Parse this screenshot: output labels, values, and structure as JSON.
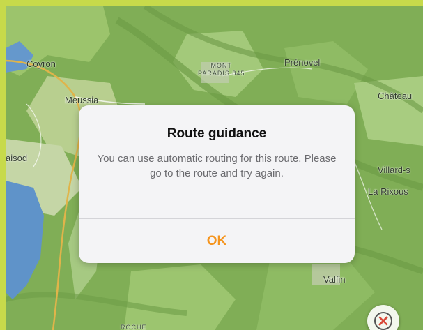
{
  "map": {
    "labels": {
      "coyron": "Coyron",
      "meussia": "Meussia",
      "mont_line1": "MONT",
      "mont_line2": "PARADIS 845",
      "prenovel": "Prénovel",
      "chateau": "Château",
      "aisod": "aisod",
      "villard": "Villard-s",
      "rixouse": "La Rixous",
      "valfin": "Valfin",
      "roche": "ROCHE"
    },
    "colors": {
      "forest": "#7fae55",
      "meadow": "#b9d08a",
      "water": "#5f93c9",
      "road": "#e0b44a"
    },
    "compass_icon": "compass-icon"
  },
  "dialog": {
    "title": "Route guidance",
    "message": "You can use automatic routing for this route. Please go to the route and try again.",
    "ok_label": "OK",
    "accent_color": "#f5951f"
  }
}
